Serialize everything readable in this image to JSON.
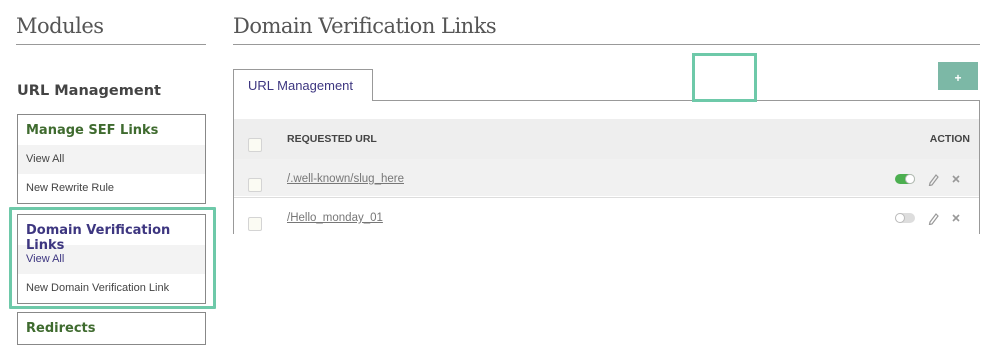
{
  "sidebar": {
    "title": "Modules",
    "section_title": "URL Management",
    "groups": [
      {
        "title": "Manage SEF Links",
        "items": [
          "View All",
          "New Rewrite Rule"
        ]
      },
      {
        "title": "Domain Verification Links",
        "items": [
          "View All",
          "New Domain Verification Link"
        ]
      },
      {
        "title": "Redirects",
        "items": []
      }
    ]
  },
  "main": {
    "title": "Domain Verification Links",
    "tab_label": "URL Management",
    "add_label": "+",
    "table": {
      "col_url": "REQUESTED URL",
      "col_action": "ACTION",
      "rows": [
        {
          "url": "/.well-known/slug_here",
          "enabled": true
        },
        {
          "url": "/Hello_monday_01",
          "enabled": false
        }
      ]
    }
  },
  "colors": {
    "accent": "#6ec9a9",
    "button": "#7cb8a6",
    "green": "#3f6b2f",
    "purple": "#3d3680",
    "toggle_on": "#4caf50"
  }
}
